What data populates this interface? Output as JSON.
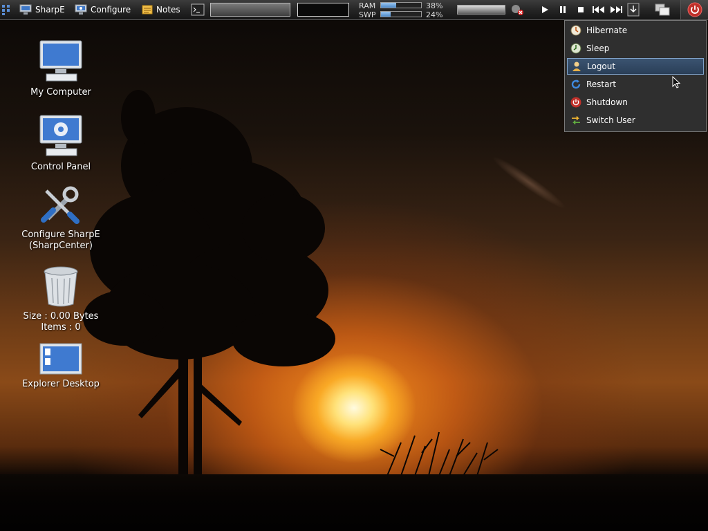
{
  "panel": {
    "buttons": [
      {
        "label": "SharpE",
        "icon": "computer-icon"
      },
      {
        "label": "Configure",
        "icon": "monitor-gear-icon"
      },
      {
        "label": "Notes",
        "icon": "notes-icon"
      }
    ],
    "meters": {
      "ram": {
        "label": "RAM",
        "value": "38%",
        "fraction": 0.38
      },
      "swp": {
        "label": "SWP",
        "value": "24%",
        "fraction": 0.24
      }
    },
    "media_controls": [
      "play-icon",
      "pause-icon",
      "stop-icon",
      "previous-icon",
      "next-icon"
    ]
  },
  "desktop": {
    "icons": [
      {
        "label": "My Computer",
        "icon": "computer-icon"
      },
      {
        "label": "Control Panel",
        "icon": "control-panel-icon"
      },
      {
        "label": "Configure SharpE\n(SharpCenter)",
        "icon": "tools-icon"
      },
      {
        "label": "Size : 0.00 Bytes\nItems : 0",
        "icon": "recycle-bin-icon"
      },
      {
        "label": "Explorer Desktop",
        "icon": "explorer-desktop-icon"
      }
    ]
  },
  "power_menu": {
    "items": [
      {
        "label": "Hibernate",
        "icon": "hibernate-icon",
        "selected": false
      },
      {
        "label": "Sleep",
        "icon": "sleep-icon",
        "selected": false
      },
      {
        "label": "Logout",
        "icon": "logout-icon",
        "selected": true
      },
      {
        "label": "Restart",
        "icon": "restart-icon",
        "selected": false
      },
      {
        "label": "Shutdown",
        "icon": "shutdown-icon",
        "selected": false
      },
      {
        "label": "Switch User",
        "icon": "switch-user-icon",
        "selected": false
      }
    ]
  },
  "colors": {
    "panel_bg": "#262626",
    "menu_bg": "#2f2f2f",
    "menu_selection": "#2a3f58",
    "power_button": "#c0302a",
    "meter_fill": "#4a87c8"
  }
}
